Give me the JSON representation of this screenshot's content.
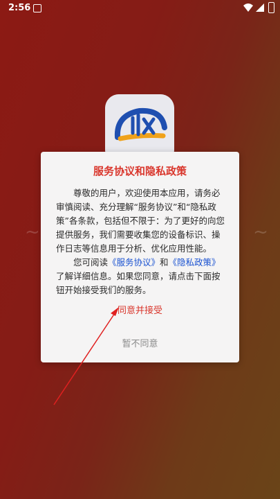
{
  "status_bar": {
    "time": "2:56"
  },
  "dialog": {
    "title": "服务协议和隐私政策",
    "para1": "尊敬的用户，欢迎使用本应用，请务必审慎阅读、充分理解“服务协议”和“隐私政策”各条款，包括但不限于：为了更好的向您提供服务，我们需要收集您的设备标识、操作日志等信息用于分析、优化应用性能。",
    "para2_prefix": "您可阅读",
    "link_service": "《服务协议》",
    "and": "和",
    "link_privacy": "《隐私政策》",
    "para2_suffix": "了解详细信息。如果您同意，请点击下面按钮开始接受我们的服务。",
    "agree_label": "同意并接受",
    "disagree_label": "暂不同意"
  },
  "colors": {
    "accent_red": "#d9362c",
    "link_blue": "#1a52d1",
    "annotation_arrow": "#e02020"
  },
  "icons": [
    "notification-icon",
    "wifi-icon",
    "signal-icon",
    "battery-icon",
    "app-logo-icon"
  ]
}
